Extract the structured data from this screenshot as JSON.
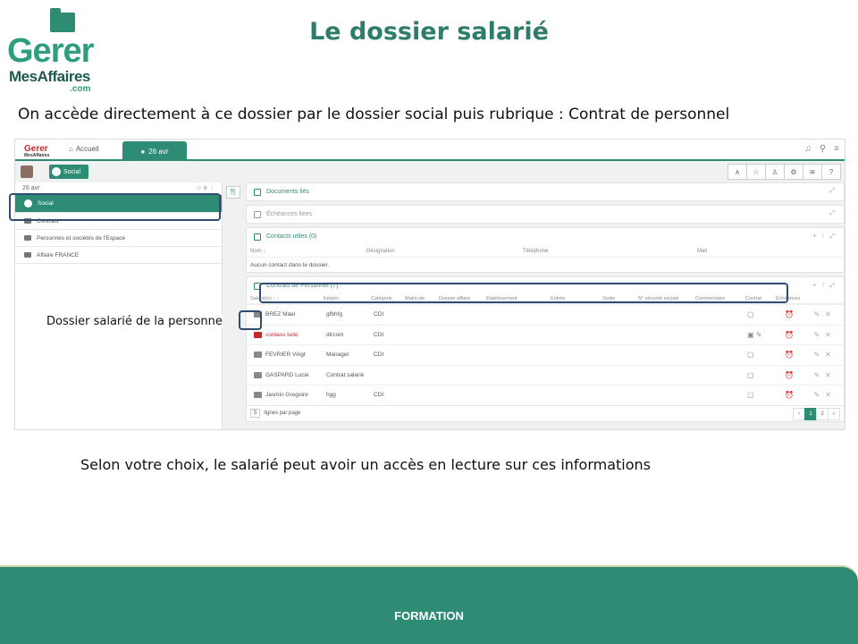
{
  "slide": {
    "title": "Le dossier salarié",
    "intro": "On accède directement à ce dossier par le dossier social puis rubrique : Contrat de personnel",
    "side_note": "Dossier salarié de la personne",
    "outro": "Selon votre choix, le salarié peut avoir un accès en lecture sur ces informations",
    "footer": "FORMATION"
  },
  "logo": {
    "line1": "Gerer",
    "line2": "MesAffaires",
    "line3": ".com"
  },
  "app": {
    "mini_logo": {
      "line1": "Gerer",
      "line2": "MesAffaires"
    },
    "tabs": {
      "home": "Accueil",
      "active": "26 avr"
    },
    "top_icons": [
      "bell-icon",
      "search-icon",
      "menu-icon"
    ],
    "chip": "Social",
    "left": {
      "header": "26 avr",
      "items": [
        "Social",
        "Contrats",
        "Personnes et sociétés de l'Espace",
        "Affaire FRANCE"
      ]
    },
    "boxes": {
      "docs": "Documents liés",
      "echeances": "Échéances liées",
      "contacts": "Contacts utiles (0)",
      "contracts": "Contrats de Personnel (7)"
    },
    "contacts_cols": [
      "Nom ↓",
      "Désignation",
      "Téléphone",
      "Mail"
    ],
    "contacts_empty": "Aucun contact dans le dossier.",
    "contract_cols": [
      "Salarié(e) ↑ ↓",
      "Emploi",
      "Catégorie",
      "Matricule",
      "Dossier affaire",
      "Établissement",
      "Entrée",
      "Sortie",
      "N° sécurité sociale",
      "Commentaire",
      "Contrat",
      "Échéances"
    ],
    "contracts": [
      {
        "name": "BREZ Mael",
        "emploi": "gfbhfg",
        "cat": "CDI",
        "red": false
      },
      {
        "name": "contass ludo",
        "emploi": "dircom",
        "cat": "CDI",
        "red": true
      },
      {
        "name": "FEVRIER Vingt",
        "emploi": "Manager",
        "cat": "CDI",
        "red": false
      },
      {
        "name": "GASPARD Lucie",
        "emploi": "Contrat salarié",
        "cat": "",
        "red": false
      },
      {
        "name": "Jasmin Gregoire",
        "emploi": "hgg",
        "cat": "CDI",
        "red": false
      }
    ],
    "pager": {
      "size": "5",
      "label": "lignes par page",
      "pages": [
        "‹",
        "1",
        "2",
        "›"
      ],
      "current": "1"
    }
  }
}
